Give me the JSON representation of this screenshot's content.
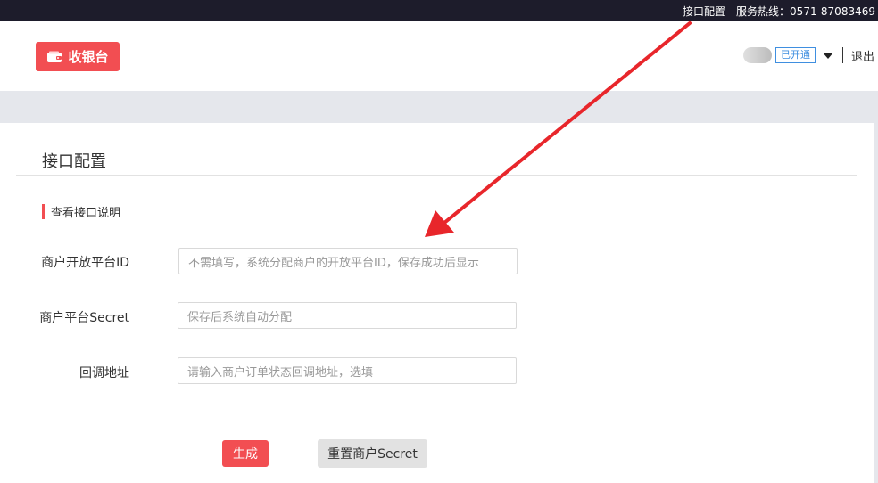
{
  "topbar": {
    "config_link": "接口配置",
    "hotline": "服务热线：0571-87083469"
  },
  "header": {
    "logo_label": "收银台",
    "status_badge": "已开通",
    "logout": "退出"
  },
  "page": {
    "title": "接口配置",
    "section_link": "查看接口说明"
  },
  "form": {
    "fields": [
      {
        "label": "商户开放平台ID",
        "placeholder": "不需填写，系统分配商户的开放平台ID，保存成功后显示"
      },
      {
        "label": "商户平台Secret",
        "placeholder": "保存后系统自动分配"
      },
      {
        "label": "回调地址",
        "placeholder": "请输入商户订单状态回调地址，选填"
      }
    ],
    "generate_label": "生成",
    "reset_label": "重置商户Secret"
  },
  "colors": {
    "accent": "#f24e52",
    "topbar": "#1d1c2b",
    "badge": "#3f8fe0",
    "annotation_arrow": "#e8262b"
  },
  "icons": {
    "logo": "wallet-icon",
    "dropdown": "caret-down-icon"
  }
}
